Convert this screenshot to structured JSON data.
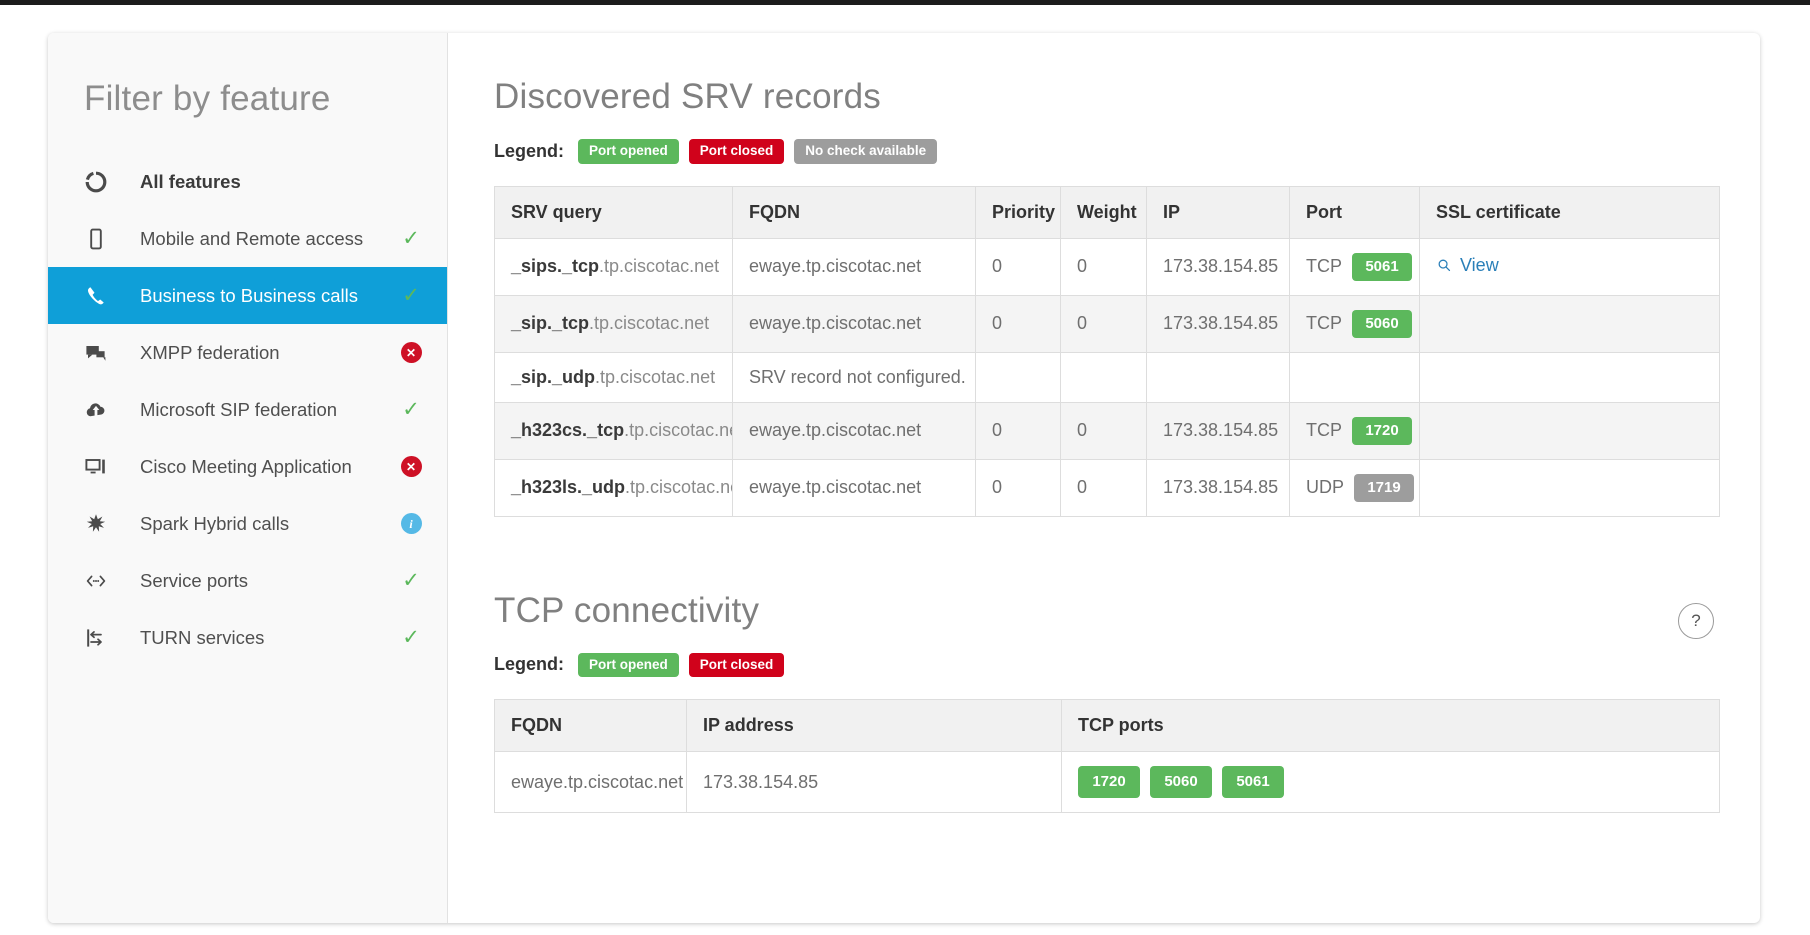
{
  "sidebar": {
    "title": "Filter by feature",
    "items": [
      {
        "label": "All features",
        "icon": "loading-ring-icon",
        "status": "none",
        "bold": true,
        "active": false
      },
      {
        "label": "Mobile and Remote access",
        "icon": "mobile-phone-icon",
        "status": "ok",
        "bold": false,
        "active": false
      },
      {
        "label": "Business to Business calls",
        "icon": "phone-handset-icon",
        "status": "ok",
        "bold": false,
        "active": true
      },
      {
        "label": "XMPP federation",
        "icon": "chat-bubbles-icon",
        "status": "error",
        "bold": false,
        "active": false
      },
      {
        "label": "Microsoft SIP federation",
        "icon": "cloud-upload-icon",
        "status": "ok",
        "bold": false,
        "active": false
      },
      {
        "label": "Cisco Meeting Application",
        "icon": "monitor-icon",
        "status": "error",
        "bold": false,
        "active": false
      },
      {
        "label": "Spark Hybrid calls",
        "icon": "asterisk-icon",
        "status": "info",
        "bold": false,
        "active": false
      },
      {
        "label": "Service ports",
        "icon": "code-brackets-icon",
        "status": "ok",
        "bold": false,
        "active": false
      },
      {
        "label": "TURN services",
        "icon": "arrows-relay-icon",
        "status": "ok",
        "bold": false,
        "active": false
      }
    ]
  },
  "srv_section": {
    "title": "Discovered SRV records",
    "legend_label": "Legend:",
    "legend": [
      {
        "text": "Port opened",
        "color": "#5cb85c",
        "cls": "green"
      },
      {
        "text": "Port closed",
        "color": "#d0021b",
        "cls": "red"
      },
      {
        "text": "No check available",
        "color": "#9d9d9d",
        "cls": "gray"
      }
    ],
    "columns": [
      "SRV query",
      "FQDN",
      "Priority",
      "Weight",
      "IP",
      "Port",
      "SSL certificate"
    ],
    "rows": [
      {
        "query_bold": "_sips._tcp",
        "query_dim": ".tp.ciscotac.net",
        "fqdn": "ewaye.tp.ciscotac.net",
        "fqdn_error": false,
        "priority": "0",
        "weight": "0",
        "ip": "173.38.154.85",
        "proto": "TCP",
        "port": "5061",
        "port_state": "green",
        "ssl": "View"
      },
      {
        "query_bold": "_sip._tcp",
        "query_dim": ".tp.ciscotac.net",
        "fqdn": "ewaye.tp.ciscotac.net",
        "fqdn_error": false,
        "priority": "0",
        "weight": "0",
        "ip": "173.38.154.85",
        "proto": "TCP",
        "port": "5060",
        "port_state": "green",
        "ssl": ""
      },
      {
        "query_bold": "_sip._udp",
        "query_dim": ".tp.ciscotac.net",
        "fqdn": "SRV record not configured.",
        "fqdn_error": true,
        "priority": "",
        "weight": "",
        "ip": "",
        "proto": "",
        "port": "",
        "port_state": "",
        "ssl": ""
      },
      {
        "query_bold": "_h323cs._tcp",
        "query_dim": ".tp.ciscotac.net",
        "fqdn": "ewaye.tp.ciscotac.net",
        "fqdn_error": false,
        "priority": "0",
        "weight": "0",
        "ip": "173.38.154.85",
        "proto": "TCP",
        "port": "1720",
        "port_state": "green",
        "ssl": ""
      },
      {
        "query_bold": "_h323ls._udp",
        "query_dim": ".tp.ciscotac.net",
        "fqdn": "ewaye.tp.ciscotac.net",
        "fqdn_error": false,
        "priority": "0",
        "weight": "0",
        "ip": "173.38.154.85",
        "proto": "UDP",
        "port": "1719",
        "port_state": "gray",
        "ssl": ""
      }
    ]
  },
  "tcp_section": {
    "title": "TCP connectivity",
    "help_label": "?",
    "legend_label": "Legend:",
    "legend": [
      {
        "text": "Port opened",
        "color": "#5cb85c",
        "cls": "green"
      },
      {
        "text": "Port closed",
        "color": "#d0021b",
        "cls": "red"
      }
    ],
    "columns": [
      "FQDN",
      "IP address",
      "TCP ports"
    ],
    "rows": [
      {
        "fqdn": "ewaye.tp.ciscotac.net",
        "ip": "173.38.154.85",
        "ports": [
          {
            "port": "1720",
            "state": "green"
          },
          {
            "port": "5060",
            "state": "green"
          },
          {
            "port": "5061",
            "state": "green"
          }
        ]
      }
    ]
  },
  "colors": {
    "accent_blue": "#0f9fd8",
    "link_blue": "#2a7fb8",
    "ok_green": "#5cb85c",
    "error_red": "#ce1126",
    "info_blue": "#55b9e6",
    "neutral_gray": "#9d9d9d"
  }
}
